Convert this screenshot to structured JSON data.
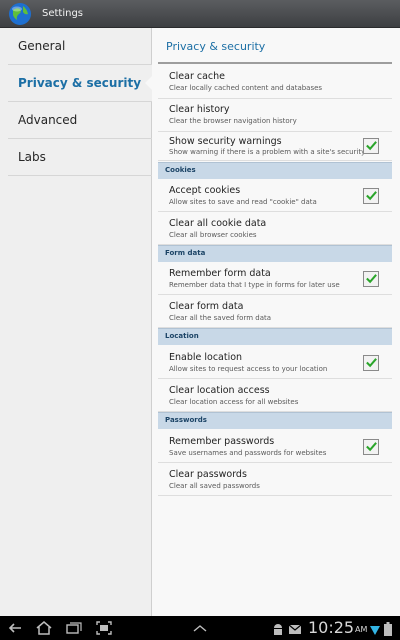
{
  "window": {
    "title": "Settings",
    "app_icon": "globe-icon"
  },
  "sidebar": {
    "items": [
      {
        "label": "General",
        "active": false
      },
      {
        "label": "Privacy & security",
        "active": true
      },
      {
        "label": "Advanced",
        "active": false
      },
      {
        "label": "Labs",
        "active": false
      }
    ]
  },
  "main": {
    "title": "Privacy & security",
    "prefs": {
      "clear_cache": {
        "title": "Clear cache",
        "summary": "Clear locally cached content and databases"
      },
      "clear_history": {
        "title": "Clear history",
        "summary": "Clear the browser navigation history"
      },
      "show_warnings": {
        "title": "Show security warnings",
        "summary": "Show warning if there is a problem with a site's security",
        "checked": true
      },
      "accept_cookies": {
        "title": "Accept cookies",
        "summary": "Allow sites to save and read \"cookie\" data",
        "checked": true
      },
      "clear_cookies": {
        "title": "Clear all cookie data",
        "summary": "Clear all browser cookies"
      },
      "remember_form": {
        "title": "Remember form data",
        "summary": "Remember data that I type in forms for later use",
        "checked": true
      },
      "clear_form": {
        "title": "Clear form data",
        "summary": "Clear all the saved form data"
      },
      "enable_location": {
        "title": "Enable location",
        "summary": "Allow sites to request access to your location",
        "checked": true
      },
      "clear_location": {
        "title": "Clear location access",
        "summary": "Clear location access for all websites"
      },
      "remember_passwords": {
        "title": "Remember passwords",
        "summary": "Save usernames and passwords for websites",
        "checked": true
      },
      "clear_passwords": {
        "title": "Clear passwords",
        "summary": "Clear all saved passwords"
      }
    },
    "categories": {
      "cookies": "Cookies",
      "form_data": "Form data",
      "location": "Location",
      "passwords": "Passwords"
    }
  },
  "system_bar": {
    "clock": "10:25",
    "ampm": "AM",
    "nav_buttons": [
      "back-icon",
      "home-icon",
      "recent-apps-icon",
      "screenshot-icon",
      "menu-up-icon"
    ],
    "status_icons": [
      "android-debug-icon",
      "gmail-icon",
      "wifi-icon",
      "battery-icon"
    ]
  },
  "colors": {
    "accent": "#1c6fa5",
    "category_bg": "#c8d8e7",
    "checkbox_check": "#2aa52a"
  }
}
